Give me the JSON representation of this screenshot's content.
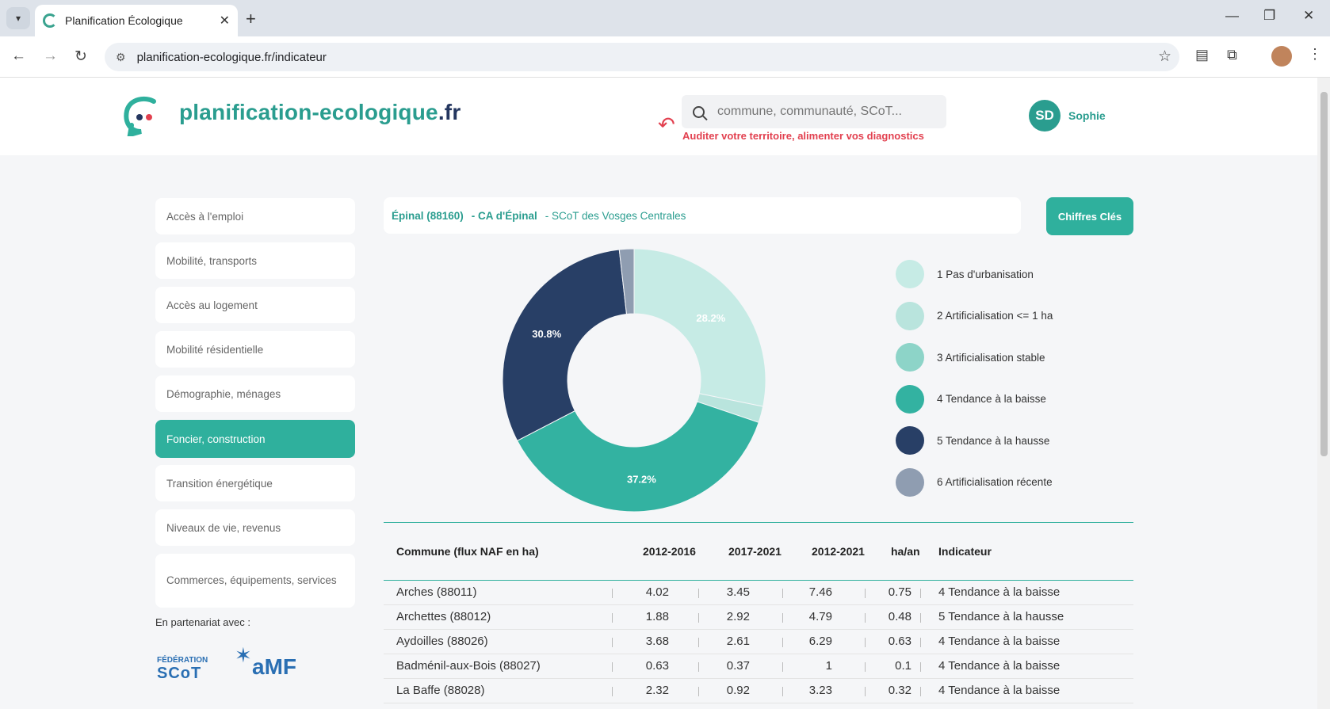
{
  "browser": {
    "tab_title": "Planification Écologique",
    "url": "planification-ecologique.fr/indicateur"
  },
  "header": {
    "logo_main": "planification-ecologique",
    "logo_tld": ".fr",
    "search_placeholder": "commune, communauté, SCoT...",
    "audit_text": "Auditer votre territoire, alimenter vos diagnostics",
    "user_initials": "SD",
    "user_name": "Sophie"
  },
  "sidebar": {
    "items": [
      {
        "label": "Accès à l'emploi"
      },
      {
        "label": "Mobilité, transports"
      },
      {
        "label": "Accès au logement"
      },
      {
        "label": "Mobilité résidentielle"
      },
      {
        "label": "Démographie, ménages"
      },
      {
        "label": "Foncier, construction"
      },
      {
        "label": "Transition énergétique"
      },
      {
        "label": "Niveaux de vie, revenus"
      },
      {
        "label": "Commerces, équipements, services"
      }
    ],
    "partner_label": "En partenariat avec :",
    "fed_line1": "FÉDÉRATION",
    "fed_line2": "SCoT",
    "amf_text": "aMF"
  },
  "breadcrumb": {
    "commune": "Épinal (88160)",
    "ca": "- CA d'Épinal",
    "scot": "- SCoT des Vosges Centrales"
  },
  "key_button": "Chiffres Clés",
  "chart_data": {
    "type": "pie",
    "style": "donut",
    "slices": [
      {
        "label": "1 Pas d'urbanisation",
        "value": 28.2,
        "color": "#c6ebe5",
        "shown_label": "28.2%"
      },
      {
        "label": "2 Artificialisation <= 1 ha",
        "value": 2.0,
        "color": "#b9e4dd",
        "shown_label": ""
      },
      {
        "label": "3 Artificialisation stable",
        "value": 0.0,
        "color": "#8dd4c8",
        "shown_label": ""
      },
      {
        "label": "4 Tendance à la baisse",
        "value": 37.2,
        "color": "#33b2a1",
        "shown_label": "37.2%"
      },
      {
        "label": "5 Tendance à la hausse",
        "value": 30.8,
        "color": "#283f66",
        "shown_label": "30.8%"
      },
      {
        "label": "6 Artificialisation récente",
        "value": 1.8,
        "color": "#8f9db1",
        "shown_label": ""
      }
    ]
  },
  "table": {
    "headers": [
      "Commune (flux NAF en ha)",
      "2012-2016",
      "2017-2021",
      "2012-2021",
      "ha/an",
      "Indicateur"
    ],
    "rows": [
      [
        "Arches (88011)",
        "4.02",
        "3.45",
        "7.46",
        "0.75",
        "4 Tendance à la baisse"
      ],
      [
        "Archettes (88012)",
        "1.88",
        "2.92",
        "4.79",
        "0.48",
        "5 Tendance à la hausse"
      ],
      [
        "Aydoilles (88026)",
        "3.68",
        "2.61",
        "6.29",
        "0.63",
        "4 Tendance à la baisse"
      ],
      [
        "Badménil-aux-Bois (88027)",
        "0.63",
        "0.37",
        "1",
        "0.1",
        "4 Tendance à la baisse"
      ],
      [
        "La Baffe (88028)",
        "2.32",
        "0.92",
        "3.23",
        "0.32",
        "4 Tendance à la baisse"
      ]
    ]
  }
}
